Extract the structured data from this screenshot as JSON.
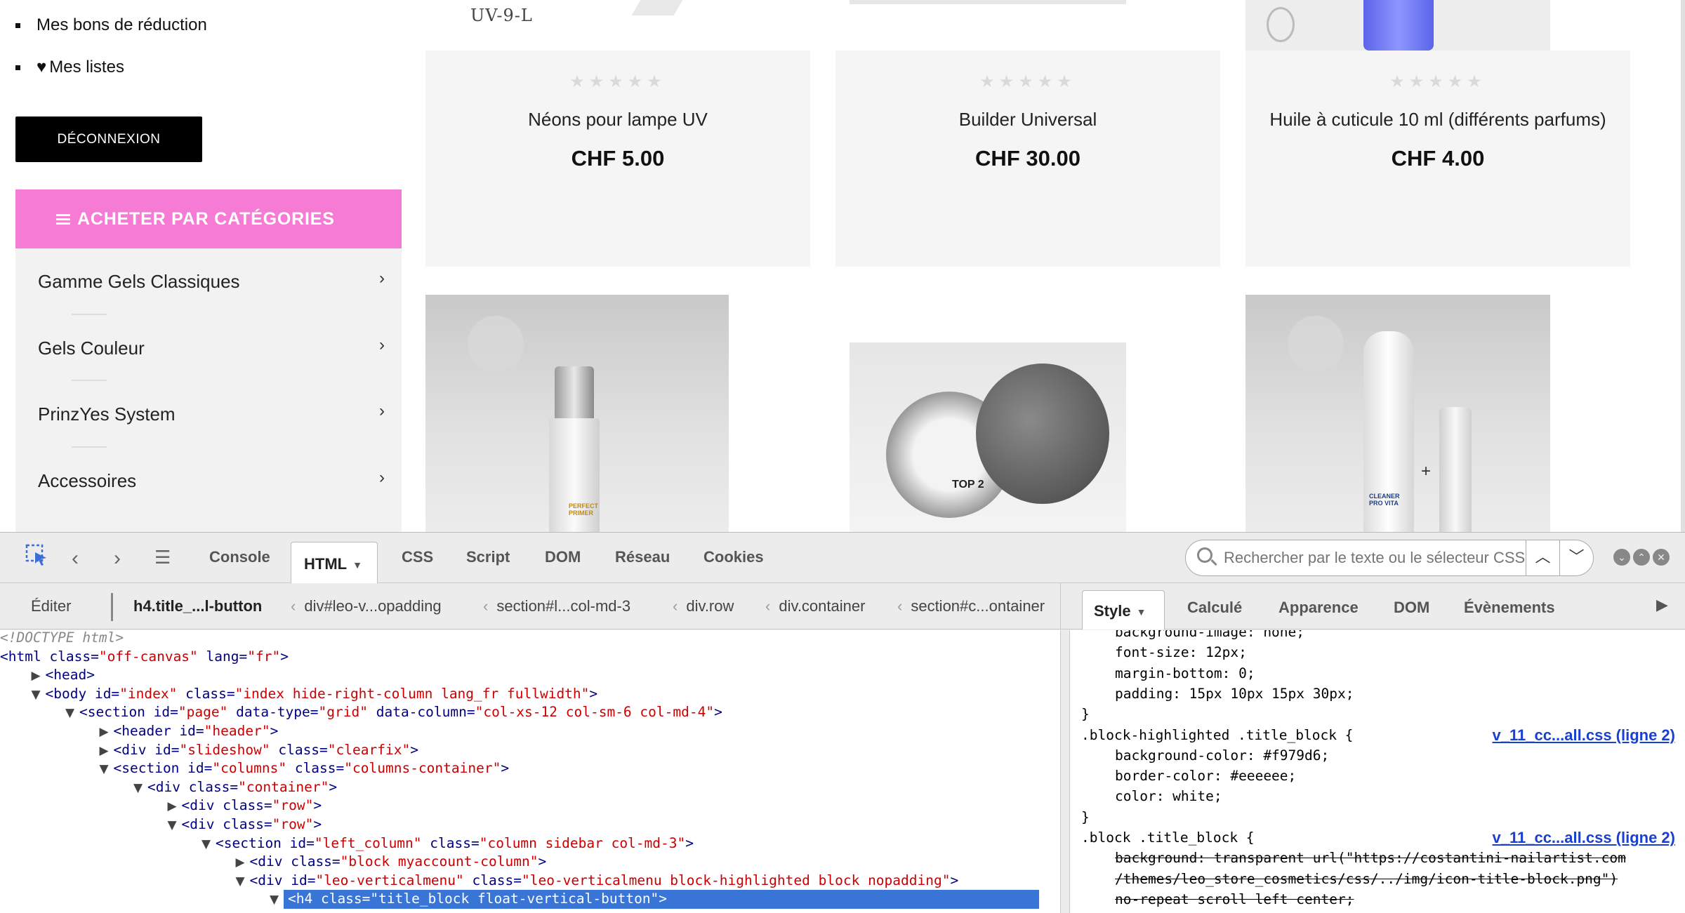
{
  "account": {
    "items": [
      "Mes bons de réduction",
      "Mes listes"
    ],
    "logout_label": "DÉCONNEXION"
  },
  "categories": {
    "header": "ACHETER PAR CATÉGORIES",
    "items": [
      "Gamme Gels Classiques",
      "Gels Couleur",
      "PrinzYes System",
      "Accessoires"
    ]
  },
  "top_image_label": "UV-9-L",
  "products": [
    {
      "name": "Néons pour lampe UV",
      "price": "CHF 5.00",
      "stars": "★★★★★"
    },
    {
      "name": "Builder Universal",
      "price": "CHF 30.00",
      "stars": "★★★★★"
    },
    {
      "name": "Huile à cuticule 10 ml (différents parfums)",
      "price": "CHF 4.00",
      "stars": "★★★★★"
    }
  ],
  "product_images": {
    "primer_label": "PERFECT PRIMER",
    "jar_label": "TOP 2",
    "cleaner_label": "CLEANER PRO VITA"
  },
  "devtools": {
    "tabs": [
      "Console",
      "HTML",
      "CSS",
      "Script",
      "DOM",
      "Réseau",
      "Cookies"
    ],
    "active_tab": "HTML",
    "search_placeholder": "Rechercher par le texte ou le sélecteur CSS",
    "breadcrumb": [
      "Éditer",
      "h4.title_...l-button",
      "div#leo-v...opadding",
      "section#l...col-md-3",
      "div.row",
      "div.container",
      "section#c...ontainer"
    ],
    "side_tabs": [
      "Style",
      "Calculé",
      "Apparence",
      "DOM",
      "Évènements"
    ],
    "active_side_tab": "Style",
    "html_lines": [
      {
        "indent": 0,
        "toggle": "",
        "text": "<!DOCTYPE html>",
        "kind": "doctype"
      },
      {
        "indent": 0,
        "toggle": "",
        "tag": "html",
        "attrs": [
          [
            "class",
            "off-canvas"
          ],
          [
            "lang",
            "fr"
          ]
        ]
      },
      {
        "indent": 1,
        "toggle": "▶",
        "tag": "head",
        "attrs": []
      },
      {
        "indent": 1,
        "toggle": "▼",
        "tag": "body",
        "attrs": [
          [
            "id",
            "index"
          ],
          [
            "class",
            "index hide-right-column lang_fr fullwidth"
          ]
        ]
      },
      {
        "indent": 2,
        "toggle": "▼",
        "tag": "section",
        "attrs": [
          [
            "id",
            "page"
          ],
          [
            "data-type",
            "grid"
          ],
          [
            "data-column",
            "col-xs-12 col-sm-6 col-md-4"
          ]
        ]
      },
      {
        "indent": 3,
        "toggle": "▶",
        "tag": "header",
        "attrs": [
          [
            "id",
            "header"
          ]
        ]
      },
      {
        "indent": 3,
        "toggle": "▶",
        "tag": "div",
        "attrs": [
          [
            "id",
            "slideshow"
          ],
          [
            "class",
            "clearfix"
          ]
        ]
      },
      {
        "indent": 3,
        "toggle": "▼",
        "tag": "section",
        "attrs": [
          [
            "id",
            "columns"
          ],
          [
            "class",
            "columns-container"
          ]
        ]
      },
      {
        "indent": 4,
        "toggle": "▼",
        "tag": "div",
        "attrs": [
          [
            "class",
            "container"
          ]
        ]
      },
      {
        "indent": 5,
        "toggle": "▶",
        "tag": "div",
        "attrs": [
          [
            "class",
            "row"
          ]
        ]
      },
      {
        "indent": 5,
        "toggle": "▼",
        "tag": "div",
        "attrs": [
          [
            "class",
            "row"
          ]
        ]
      },
      {
        "indent": 6,
        "toggle": "▼",
        "tag": "section",
        "attrs": [
          [
            "id",
            "left_column"
          ],
          [
            "class",
            "column sidebar col-md-3"
          ]
        ]
      },
      {
        "indent": 7,
        "toggle": "▶",
        "tag": "div",
        "attrs": [
          [
            "class",
            "block myaccount-column"
          ]
        ]
      },
      {
        "indent": 7,
        "toggle": "▼",
        "tag": "div",
        "attrs": [
          [
            "id",
            "leo-verticalmenu"
          ],
          [
            "class",
            "leo-verticalmenu block-highlighted block nopadding"
          ]
        ]
      },
      {
        "indent": 8,
        "toggle": "▼",
        "tag": "h4",
        "attrs": [
          [
            "class",
            "title_block float-vertical-button"
          ]
        ],
        "selected": true
      }
    ],
    "css_lines": [
      {
        "text": "background-image: none;",
        "ind": true,
        "clip": true
      },
      {
        "text": "font-size: 12px;",
        "ind": true
      },
      {
        "text": "margin-bottom: 0;",
        "ind": true
      },
      {
        "text": "padding: 15px 10px 15px 30px;",
        "ind": true
      },
      {
        "text": "}",
        "ind": false
      },
      {
        "text": ".block-highlighted .title_block {",
        "ind": false,
        "src": "v_11_cc...all.css (ligne 2)"
      },
      {
        "text": "background-color: #f979d6;",
        "ind": true
      },
      {
        "text": "border-color: #eeeeee;",
        "ind": true
      },
      {
        "text": "color: white;",
        "ind": true
      },
      {
        "text": "}",
        "ind": false
      },
      {
        "text": ".block .title_block {",
        "ind": false,
        "src": "v_11_cc...all.css (ligne 2)"
      },
      {
        "text": "background: transparent url(\"https://costantini-nailartist.com",
        "ind": true,
        "strike": true
      },
      {
        "text": "/themes/leo_store_cosmetics/css/../img/icon-title-block.png\")",
        "ind": true,
        "strike": true
      },
      {
        "text": "no-repeat scroll left center;",
        "ind": true,
        "strike": true
      }
    ]
  }
}
